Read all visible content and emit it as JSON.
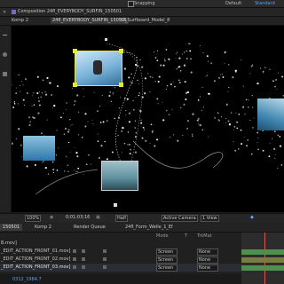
{
  "menu": {
    "workspaces": [
      "Default",
      "Standard"
    ],
    "snapping_label": "Snapping"
  },
  "composition": {
    "header": "Composition 24fl_EVERYBODY_SURFIN_150501"
  },
  "tabs": [
    {
      "label": "Komp 2"
    },
    {
      "label": "24fl_EVERYBODY_SURFIN_150501"
    },
    {
      "label": "3D_Surfboard_Model_8"
    }
  ],
  "viewer_bar": {
    "zoom": "100%",
    "timecode": "0;01;03;16",
    "resolution": "Half",
    "camera": "Active Camera",
    "views": "1 View"
  },
  "timeline": {
    "tabs": [
      {
        "label": "150501"
      },
      {
        "label": "Komp 2"
      },
      {
        "label": "Render Queue"
      },
      {
        "label": "24fl_Form_Welle_1_Ef"
      }
    ],
    "header": {
      "mode": "Mode",
      "trkmat": "TrkMat",
      "t": "T"
    },
    "layers": [
      {
        "name": "B.mov]",
        "mode": "",
        "trkmat": ""
      },
      {
        "name": "_EDIT_ACTION_FRONT_01.mov]",
        "mode": "Screen",
        "trkmat": "None"
      },
      {
        "name": "_EDIT_ACTION_FRONT_02.mov]",
        "mode": "Screen",
        "trkmat": "None"
      },
      {
        "name": "_EDIT_ACTION_FRONT_03.mov]",
        "mode": "Screen",
        "trkmat": "None"
      }
    ],
    "footer": "0312_1964.7"
  },
  "colors": {
    "accent": "#2d8cf0",
    "selection": "#e5e83a",
    "layer_bar_green": "#4f8f4f",
    "layer_bar_olive": "#7b7b45"
  }
}
